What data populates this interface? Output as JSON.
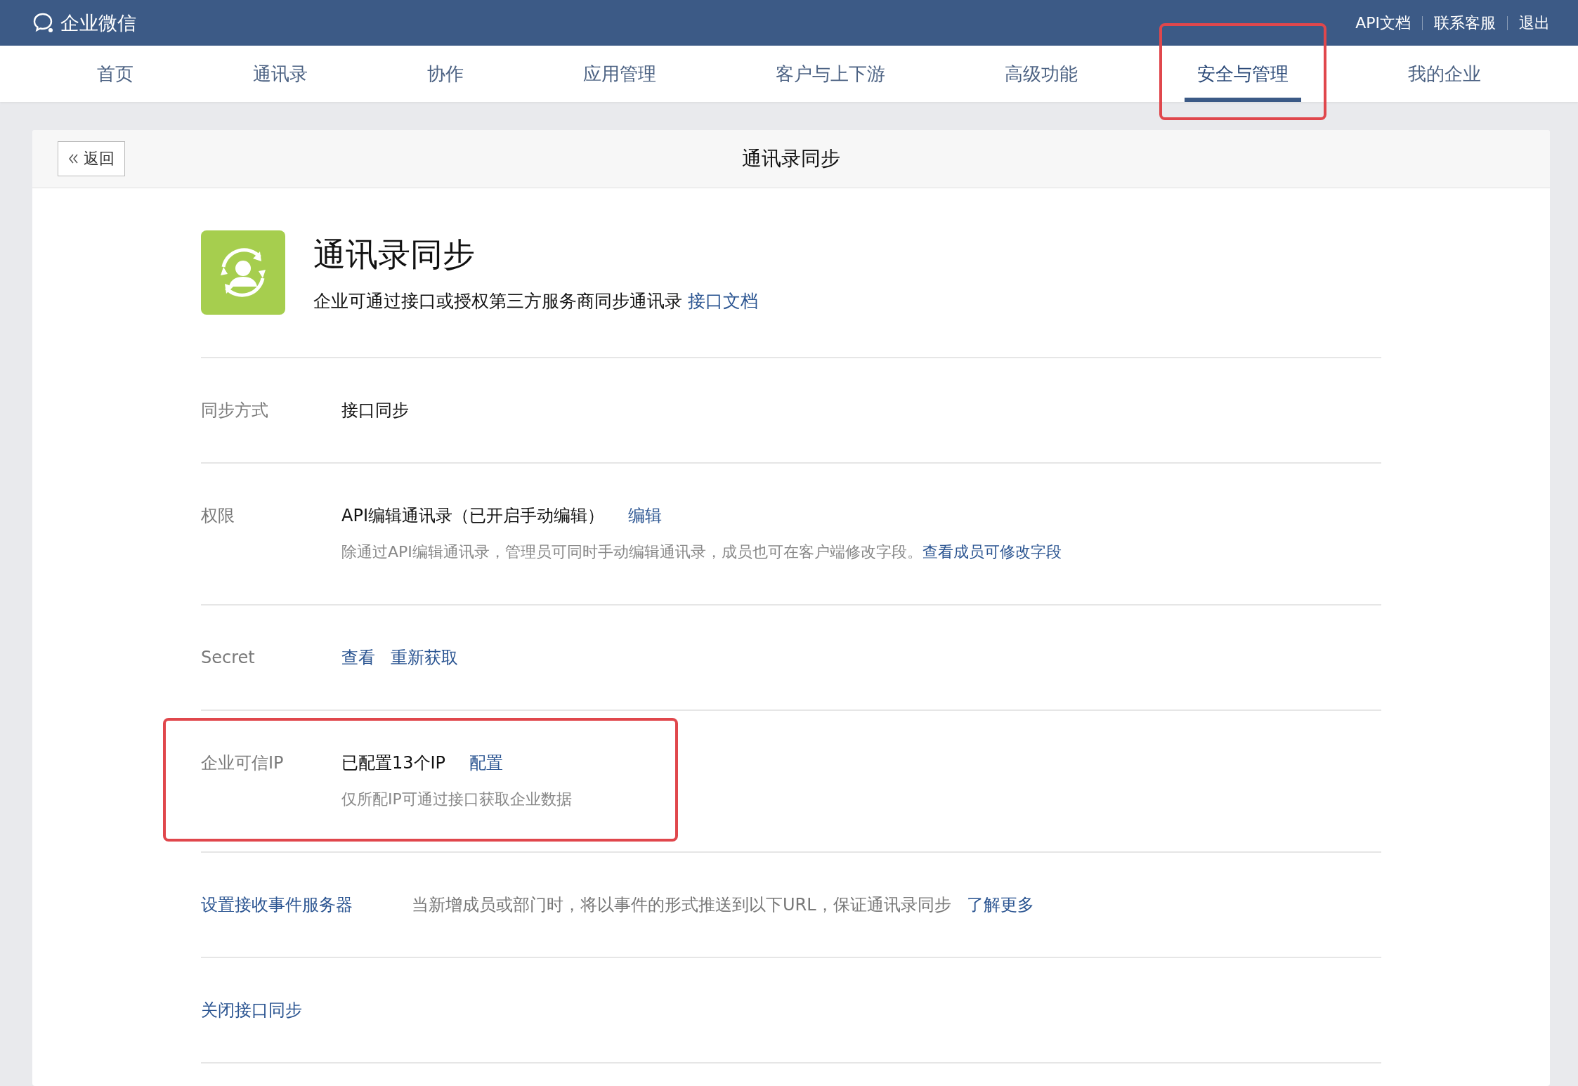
{
  "topbar": {
    "brand": "企业微信",
    "links": [
      "API文档",
      "联系客服",
      "退出"
    ]
  },
  "nav": [
    {
      "label": "首页",
      "selected": false,
      "highlighted": false
    },
    {
      "label": "通讯录",
      "selected": false,
      "highlighted": false
    },
    {
      "label": "协作",
      "selected": false,
      "highlighted": false
    },
    {
      "label": "应用管理",
      "selected": false,
      "highlighted": false
    },
    {
      "label": "客户与上下游",
      "selected": false,
      "highlighted": false
    },
    {
      "label": "高级功能",
      "selected": false,
      "highlighted": false
    },
    {
      "label": "安全与管理",
      "selected": true,
      "highlighted": true
    },
    {
      "label": "我的企业",
      "selected": false,
      "highlighted": false
    }
  ],
  "header": {
    "back": "返回",
    "title": "通讯录同步"
  },
  "app": {
    "title": "通讯录同步",
    "description": "企业可通过接口或授权第三方服务商同步通讯录",
    "link": "接口文档"
  },
  "rows": [
    {
      "label": "同步方式",
      "kind": "text",
      "value": "接口同步",
      "highlighted": false
    },
    {
      "label": "权限",
      "kind": "text",
      "value": "API编辑通讯录（已开启手动编辑）",
      "links": [
        "编辑"
      ],
      "note": "除通过API编辑通讯录，管理员可同时手动编辑通讯录，成员也可在客户端修改字段。",
      "note_link": "查看成员可修改字段",
      "highlighted": false
    },
    {
      "label": "Secret",
      "kind": "text",
      "links": [
        "查看",
        "重新获取"
      ],
      "highlighted": false
    },
    {
      "label": "企业可信IP",
      "kind": "text",
      "value": "已配置13个IP",
      "links": [
        "配置"
      ],
      "note": "仅所配IP可通过接口获取企业数据",
      "highlighted": true
    },
    {
      "label": "设置接收事件服务器",
      "kind": "link",
      "description": "当新增成员或部门时，将以事件的形式推送到以下URL，保证通讯录同步",
      "links": [
        "了解更多"
      ],
      "highlighted": false
    },
    {
      "label": "关闭接口同步",
      "kind": "link",
      "highlighted": false
    }
  ]
}
